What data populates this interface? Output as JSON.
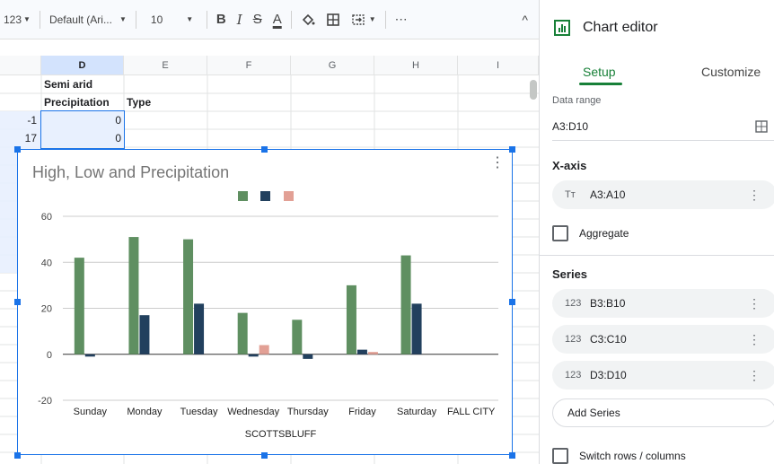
{
  "toolbar": {
    "number_format": "123",
    "font_family": "Default (Ari...",
    "font_size": "10",
    "bold": "B",
    "italic": "I",
    "strike": "S",
    "text_color": "A",
    "more": "⋯",
    "collapse": "^"
  },
  "columns": [
    "D",
    "E",
    "F",
    "G",
    "H",
    "I"
  ],
  "cells": {
    "d1": "Semi arid",
    "d2": "Precipitation",
    "e2": "Type",
    "c3": "-1",
    "d3": "0",
    "c4": "17",
    "d4": "0"
  },
  "chart": {
    "title": "High, Low and Precipitation",
    "menu": "⋮",
    "colors": [
      "#5f8f61",
      "#22405e",
      "#e2a095"
    ]
  },
  "chart_data": {
    "type": "bar",
    "title": "High, Low and Precipitation",
    "xlabel": "SCOTTSBLUFF",
    "ylabel": "",
    "ylim": [
      -20,
      60
    ],
    "yticks": [
      "60",
      "40",
      "20",
      "0",
      "-20"
    ],
    "categories": [
      "Sunday",
      "Monday",
      "Tuesday",
      "Wednesday",
      "Thursday",
      "Friday",
      "Saturday",
      "FALL CITY"
    ],
    "series": [
      {
        "values": [
          42,
          51,
          50,
          18,
          15,
          30,
          43,
          null
        ]
      },
      {
        "values": [
          -1,
          17,
          22,
          -1,
          -2,
          2,
          22,
          null
        ]
      },
      {
        "values": [
          0,
          0,
          0,
          4,
          0,
          1,
          0,
          null
        ]
      }
    ],
    "grid": true,
    "legend": "top"
  },
  "panel": {
    "title": "Chart editor",
    "tab_setup": "Setup",
    "tab_customize": "Customize",
    "data_range_label": "Data range",
    "data_range": "A3:D10",
    "xaxis_label": "X-axis",
    "xaxis_icon": "Tᴛ",
    "xaxis_range": "A3:A10",
    "aggregate": "Aggregate",
    "series_label": "Series",
    "series": [
      {
        "icon": "123",
        "range": "B3:B10"
      },
      {
        "icon": "123",
        "range": "C3:C10"
      },
      {
        "icon": "123",
        "range": "D3:D10"
      }
    ],
    "add_series": "Add Series",
    "switch_rows": "Switch rows / columns",
    "accent": "#188038"
  }
}
